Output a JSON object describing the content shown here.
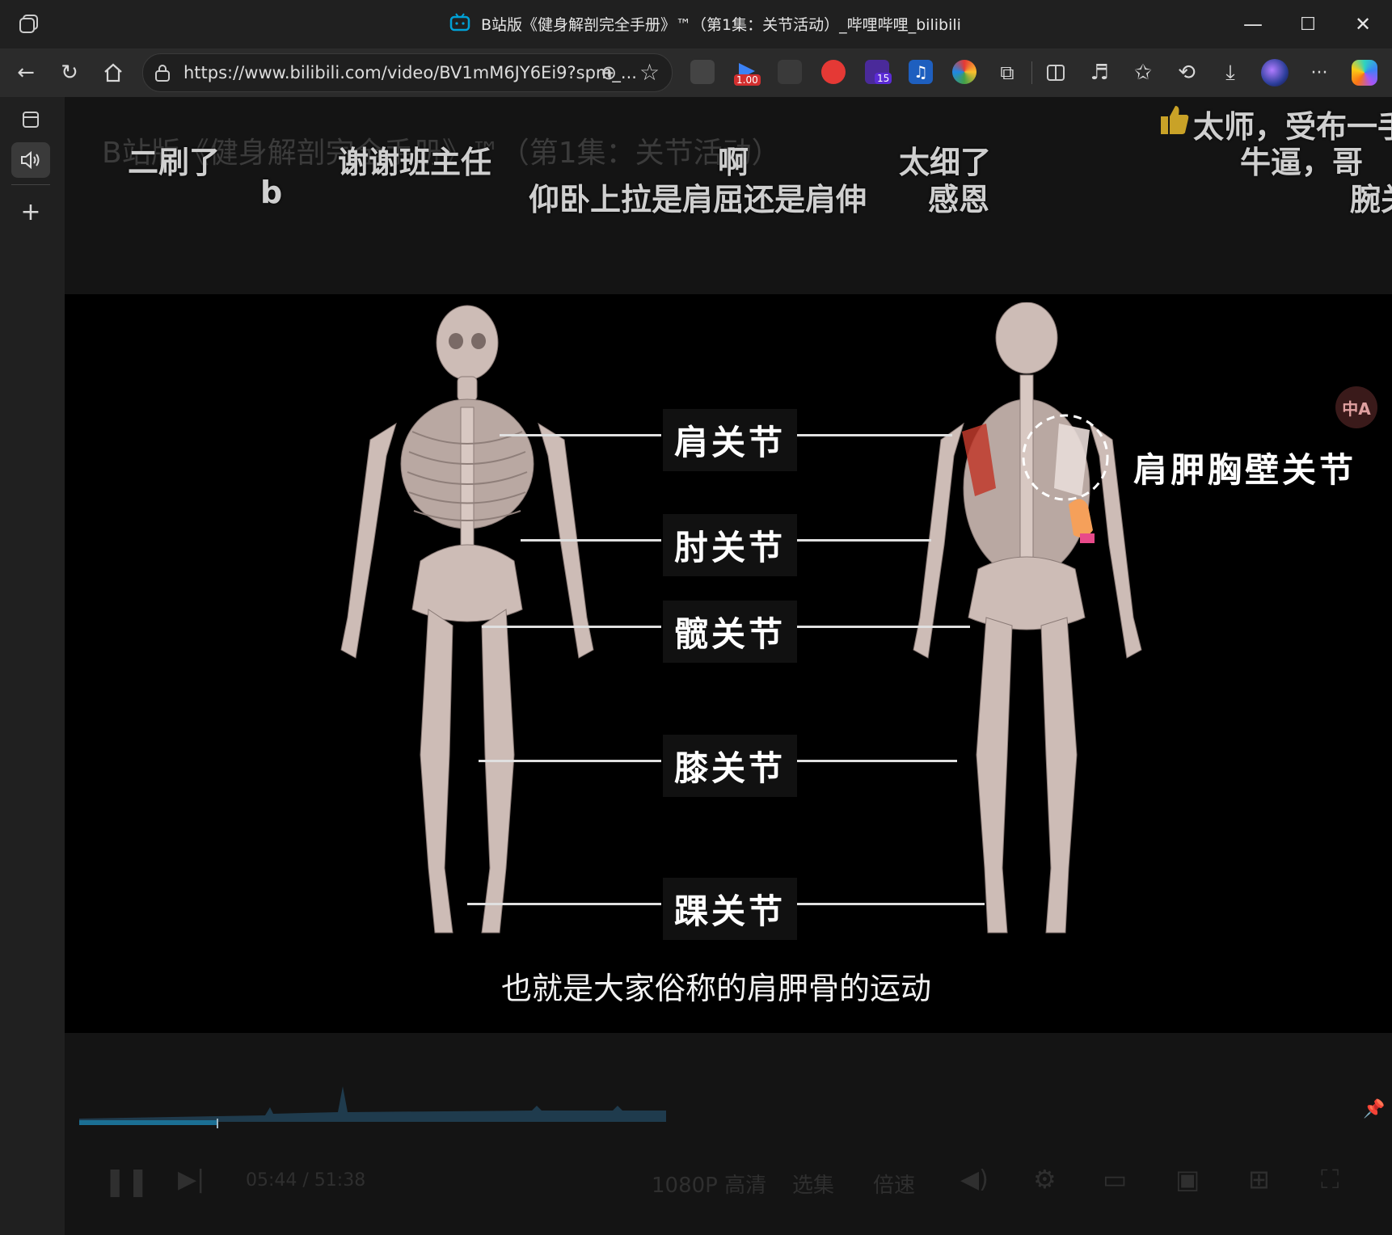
{
  "window": {
    "title": "B站版《健身解剖完全手册》™（第1集：关节活动）_哔哩哔哩_bilibili",
    "controls": {
      "minimize": "—",
      "maximize": "☐",
      "close": "✕"
    }
  },
  "toolbar": {
    "url": "https://www.bilibili.com/video/BV1mM6JY6Ei9?spm_...",
    "extension_badges": {
      "speed": "1.00",
      "count": "15"
    },
    "more": "···"
  },
  "danmaku": [
    {
      "text": "二刷了"
    },
    {
      "text": "b"
    },
    {
      "text": "谢谢班主任"
    },
    {
      "text": "啊"
    },
    {
      "text": "仰卧上拉是肩屈还是肩伸"
    },
    {
      "text": "太细了"
    },
    {
      "text": "感恩"
    },
    {
      "text": "太师，受布一手"
    },
    {
      "text": "牛逼，哥"
    },
    {
      "text": "腕关"
    }
  ],
  "ghost_title": "B站版《健身解剖完全手册》™（第1集：关节活动）",
  "video": {
    "joints": [
      "肩关节",
      "肘关节",
      "髋关节",
      "膝关节",
      "踝关节"
    ],
    "scapula_label": "肩胛胸壁关节",
    "subtitle": "也就是大家俗称的肩胛骨的运动",
    "translate_icon": "中A"
  },
  "player_controls": {
    "time": "05:44 / 51:38",
    "quality": "1080P 高清",
    "select": "选集",
    "speed": "倍速"
  },
  "colors": {
    "accent": "#00a1d6",
    "video_bg": "#000000"
  }
}
